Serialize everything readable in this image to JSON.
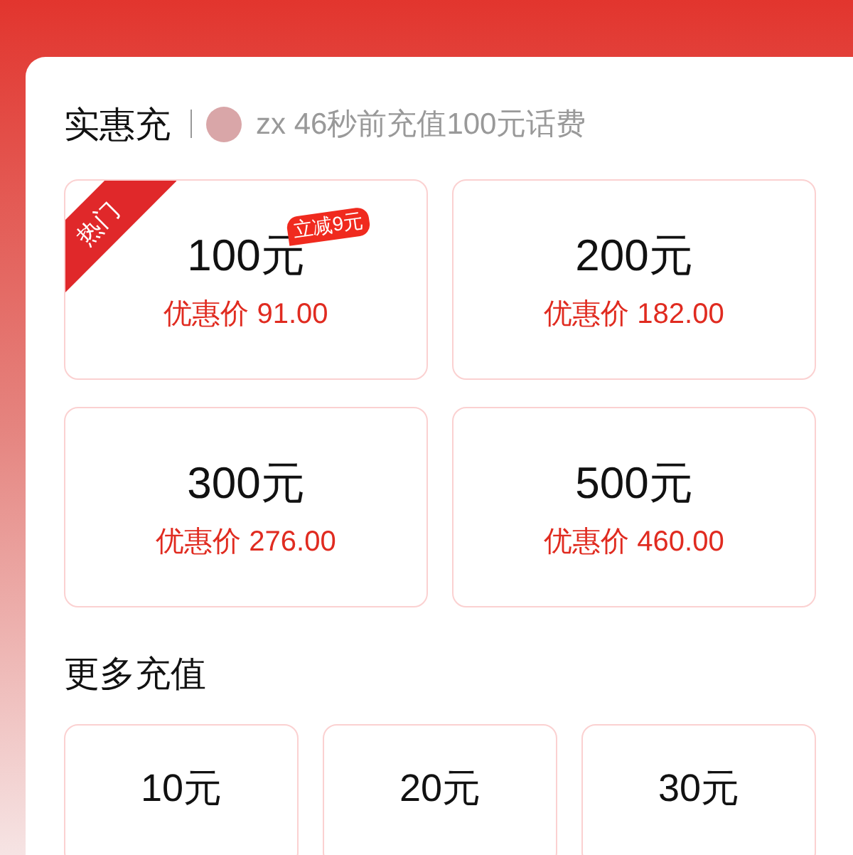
{
  "section_title": "实惠充",
  "ticker": {
    "text": "zx 46秒前充值100元话费"
  },
  "offers": [
    {
      "amount": "100元",
      "price": "优惠价 91.00",
      "tag": "热门",
      "badge": "立减9元"
    },
    {
      "amount": "200元",
      "price": "优惠价 182.00"
    },
    {
      "amount": "300元",
      "price": "优惠价 276.00"
    },
    {
      "amount": "500元",
      "price": "优惠价 460.00"
    }
  ],
  "more_title": "更多充值",
  "more_options": [
    {
      "amount": "10元"
    },
    {
      "amount": "20元"
    },
    {
      "amount": "30元"
    }
  ]
}
